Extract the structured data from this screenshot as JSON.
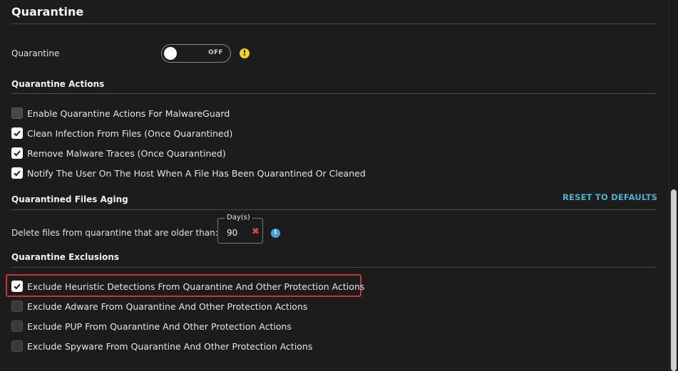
{
  "header": {
    "title": "Quarantine"
  },
  "quarantine_toggle": {
    "label": "Quarantine",
    "state": "OFF"
  },
  "actions": {
    "heading": "Quarantine Actions",
    "items": [
      {
        "label": "Enable Quarantine Actions For MalwareGuard",
        "checked": false,
        "disabled": true
      },
      {
        "label": "Clean Infection From Files (Once Quarantined)",
        "checked": true
      },
      {
        "label": "Remove Malware Traces (Once Quarantined)",
        "checked": true
      },
      {
        "label": "Notify The User On The Host When A File Has Been Quarantined Or Cleaned",
        "checked": true
      }
    ]
  },
  "aging": {
    "heading": "Quarantined Files Aging",
    "reset_label": "RESET TO DEFAULTS",
    "delete_label": "Delete files from quarantine that are older than:",
    "days_legend": "Day(s)",
    "days_value": "90"
  },
  "exclusions": {
    "heading": "Quarantine Exclusions",
    "items": [
      {
        "label": "Exclude Heuristic Detections From Quarantine And Other Protection Actions",
        "checked": true
      },
      {
        "label": "Exclude Adware From Quarantine And Other Protection Actions",
        "checked": false
      },
      {
        "label": "Exclude PUP From Quarantine And Other Protection Actions",
        "checked": false
      },
      {
        "label": "Exclude Spyware From Quarantine And Other Protection Actions",
        "checked": false
      }
    ]
  },
  "colors": {
    "accent_link": "#4fb3cf",
    "warning": "#f2d31b",
    "info": "#3fa3e0",
    "highlight": "#c8323a",
    "clear": "#e0493d"
  }
}
